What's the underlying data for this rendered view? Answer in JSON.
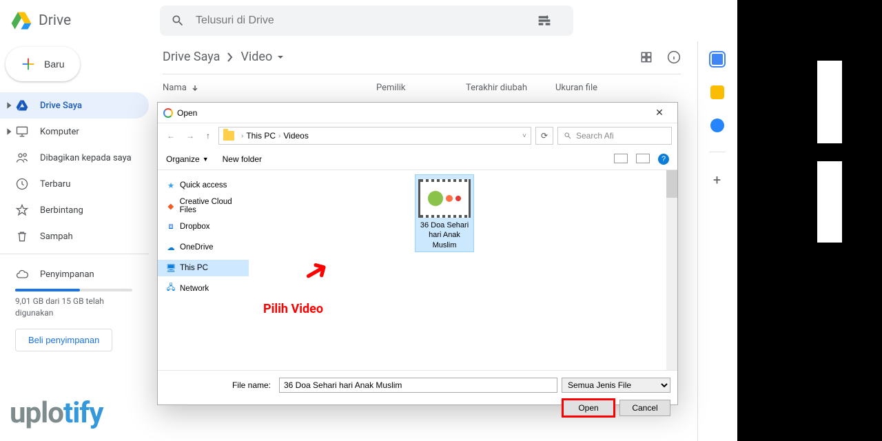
{
  "header": {
    "logo_text": "Drive",
    "search_placeholder": "Telusuri di Drive"
  },
  "sidebar": {
    "new_button": "Baru",
    "items": [
      {
        "label": "Drive Saya",
        "icon": "drive-icon",
        "active": true,
        "expandable": true
      },
      {
        "label": "Komputer",
        "icon": "computer-icon",
        "active": false,
        "expandable": true
      },
      {
        "label": "Dibagikan kepada saya",
        "icon": "shared-icon",
        "active": false,
        "expandable": false
      },
      {
        "label": "Terbaru",
        "icon": "clock-icon",
        "active": false,
        "expandable": false
      },
      {
        "label": "Berbintang",
        "icon": "star-icon",
        "active": false,
        "expandable": false
      },
      {
        "label": "Sampah",
        "icon": "trash-icon",
        "active": false,
        "expandable": false
      }
    ],
    "storage": {
      "label": "Penyimpanan",
      "usage_text": "9,01 GB dari 15 GB telah digunakan",
      "used_gb": 9.01,
      "total_gb": 15,
      "buy_button": "Beli penyimpanan"
    }
  },
  "breadcrumb": {
    "segments": [
      "Drive Saya",
      "Video"
    ]
  },
  "table": {
    "columns": {
      "name": "Nama",
      "owner": "Pemilik",
      "modified": "Terakhir diubah",
      "size": "Ukuran file"
    }
  },
  "dialog": {
    "title": "Open",
    "path_segments": [
      "This PC",
      "Videos"
    ],
    "search_placeholder": "Search Afi",
    "toolbar": {
      "organize": "Organize",
      "new_folder": "New folder"
    },
    "tree": [
      {
        "label": "Quick access",
        "icon": "star"
      },
      {
        "label": "Creative Cloud Files",
        "icon": "cc"
      },
      {
        "label": "Dropbox",
        "icon": "db"
      },
      {
        "label": "OneDrive",
        "icon": "od"
      },
      {
        "label": "This PC",
        "icon": "pc",
        "selected": true
      },
      {
        "label": "Network",
        "icon": "net"
      }
    ],
    "files": [
      {
        "name": "36 Doa Sehari hari Anak Muslim",
        "selected": true
      }
    ],
    "file_name_label": "File name:",
    "file_name_value": "36 Doa Sehari hari Anak Muslim",
    "filter_value": "Semua Jenis File",
    "open_btn": "Open",
    "cancel_btn": "Cancel"
  },
  "annotation": {
    "label": "Pilih Video"
  },
  "watermark": {
    "part1": "uplo",
    "part2": "tify"
  },
  "colors": {
    "accent": "#1a73e8",
    "red": "#ff0000"
  }
}
